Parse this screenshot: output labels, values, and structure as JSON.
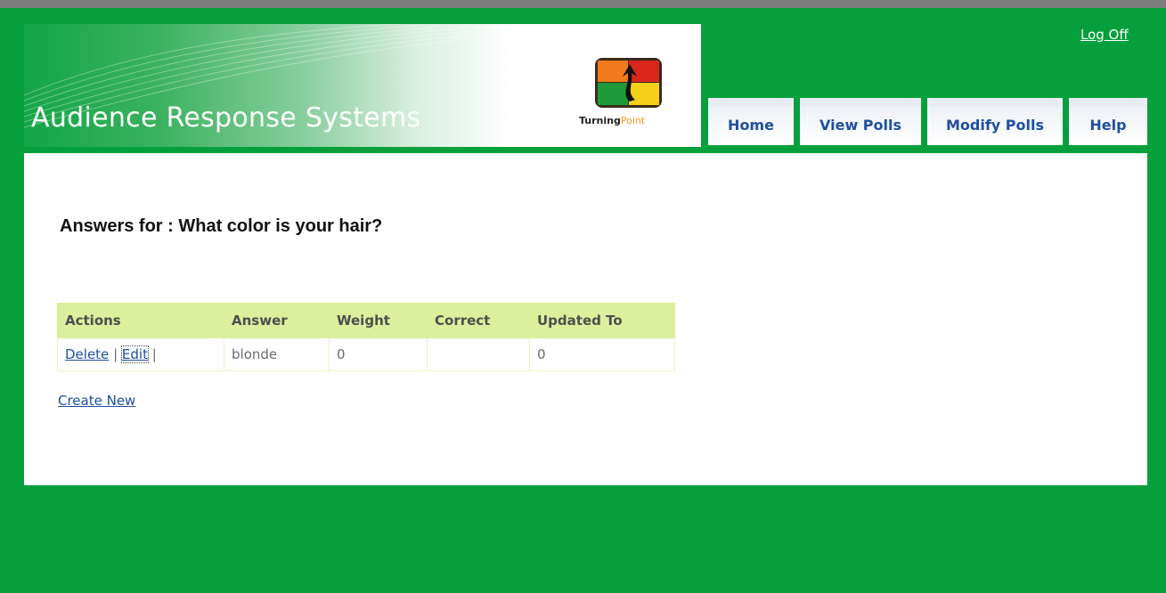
{
  "header": {
    "app_title": "Audience Response Systems",
    "logo_word_1": "Turning",
    "logo_word_2": "Point",
    "logoff_label": "Log Off"
  },
  "nav": {
    "tabs": [
      {
        "label": "Home"
      },
      {
        "label": "View Polls"
      },
      {
        "label": "Modify Polls"
      },
      {
        "label": "Help"
      }
    ]
  },
  "main": {
    "heading": "Answers for : What color is your hair?",
    "table": {
      "headers": [
        "Actions",
        "Answer",
        "Weight",
        "Correct",
        "Updated To"
      ],
      "rows": [
        {
          "delete_label": "Delete",
          "edit_label": "Edit",
          "separator": "|",
          "answer": "blonde",
          "weight": "0",
          "correct": "",
          "updated_to": "0"
        }
      ]
    },
    "create_new_label": "Create New"
  },
  "colors": {
    "page_background": "#05a03c",
    "link": "#1f4fa0",
    "table_header": "#dcef9c"
  }
}
